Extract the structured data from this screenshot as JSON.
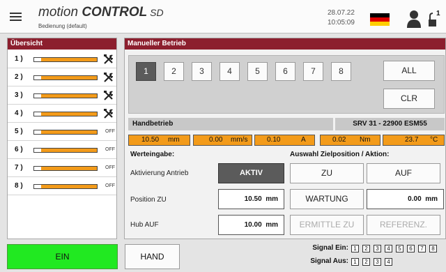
{
  "header": {
    "brand_prefix": "motion ",
    "brand_main": "CONTROL",
    "brand_suffix": " SD",
    "subtitle": "Bedienung (default)",
    "date": "28.07.22",
    "time": "10:05:09",
    "lock_badge": "1",
    "icons": [
      "hamburger-menu-icon",
      "germany-flag-icon",
      "user-icon",
      "unlock-icon"
    ]
  },
  "overview": {
    "title": "Übersicht",
    "rows": [
      {
        "label": "1 )",
        "status": "tool"
      },
      {
        "label": "2 )",
        "status": "tool"
      },
      {
        "label": "3 )",
        "status": "tool"
      },
      {
        "label": "4 )",
        "status": "tool"
      },
      {
        "label": "5 )",
        "status": "OFF"
      },
      {
        "label": "6 )",
        "status": "OFF"
      },
      {
        "label": "7 )",
        "status": "OFF"
      },
      {
        "label": "8 )",
        "status": "OFF"
      }
    ]
  },
  "manual": {
    "title": "Manueller Betrieb",
    "axis_buttons": [
      "1",
      "2",
      "3",
      "4",
      "5",
      "6",
      "7",
      "8"
    ],
    "active_axis": "1",
    "all_label": "ALL",
    "clr_label": "CLR",
    "mode_label": "Handbetrieb",
    "device_label": "SRV 31 - 22900 ESM55",
    "readouts": {
      "position": {
        "value": "10.50",
        "unit": "mm"
      },
      "speed": {
        "value": "0.00",
        "unit": "mm/s"
      },
      "current": {
        "value": "0.10",
        "unit": "A"
      },
      "torque": {
        "value": "0.02",
        "unit": "Nm"
      },
      "temperature": {
        "value": "23.7",
        "unit": "°C"
      }
    },
    "input_title": "Werteingabe:",
    "target_title": "Auswahl Zielposition / Aktion:",
    "activation_label": "Aktivierung Antrieb",
    "activation_button": "AKTIV",
    "position_zu_label": "Position ZU",
    "position_zu_value": "10.50",
    "position_zu_unit": "mm",
    "hub_auf_label": "Hub AUF",
    "hub_auf_value": "10.00",
    "hub_auf_unit": "mm",
    "zu_button": "ZU",
    "auf_button": "AUF",
    "wartung_button": "WARTUNG",
    "wartung_value": "0.00",
    "wartung_unit": "mm",
    "ermittle_button": "ERMITTLE ZU",
    "referenz_button": "REFERENZ."
  },
  "footer": {
    "ein_button": "EIN",
    "hand_button": "HAND",
    "signal_in_label": "Signal Ein:",
    "signal_in": [
      "1",
      "2",
      "3",
      "4",
      "5",
      "6",
      "7",
      "8"
    ],
    "signal_out_label": "Signal Aus:",
    "signal_out": [
      "1",
      "2",
      "3",
      "4"
    ]
  },
  "colors": {
    "accent_title": "#8c1f2e",
    "orange": "#f39b1a",
    "green": "#21e921",
    "active_gray": "#5b5b5b"
  }
}
